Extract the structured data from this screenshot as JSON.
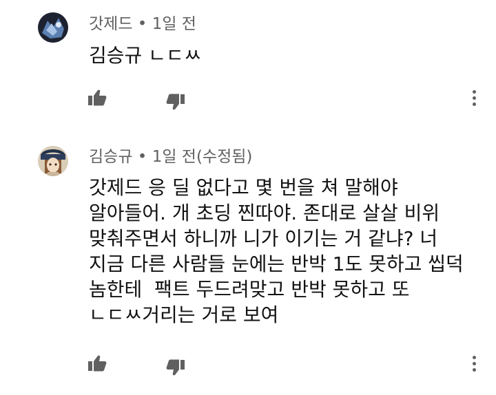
{
  "comments": [
    {
      "author": "갓제드",
      "time": "1일 전",
      "text": "김승규 ㄴㄷㅆ"
    },
    {
      "author": "김승규",
      "time": "1일 전(수정됨)",
      "lines": [
        "갓제드 응 딜 없다고 몇 번을 쳐 말해야",
        "알아들어. 개 초딩 찐따야. 존대로 살살 비위",
        "맞춰주면서 하니까 니가 이기는 거 같냐? 너",
        "지금 다른 사람들 눈에는 반박 1도 못하고 씹덕",
        "놈한테  팩트 두드려맞고 반박 못하고 또",
        "ㄴㄷㅆ거리는 거로 보여"
      ]
    }
  ],
  "meta_separator": "•",
  "icons": {
    "like": "thumb-up-icon",
    "dislike": "thumb-down-icon",
    "more": "more-vert-icon"
  },
  "colors": {
    "meta_text": "#606060",
    "body_text": "#111111",
    "icon": "#606060"
  }
}
